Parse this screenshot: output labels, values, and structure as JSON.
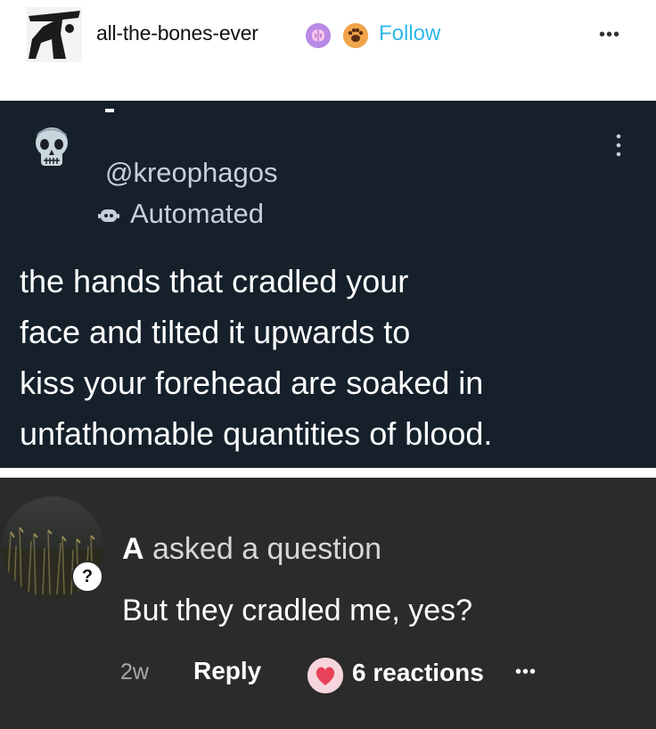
{
  "header": {
    "username": "all-the-bones-ever",
    "follow_label": "Follow",
    "more_label": "•••",
    "icons": [
      "avatar",
      "brain-badge-icon",
      "paw-badge-icon",
      "more-icon"
    ]
  },
  "tweet": {
    "handle": "@kreophagos",
    "automated_label": "Automated",
    "lines": [
      "the hands that cradled your",
      "face and tilted it upwards to",
      "kiss your forehead are soaked in",
      "unfathomable quantities of blood."
    ],
    "colors": {
      "background": "#15202b",
      "text": "#ffffff",
      "muted": "#c7cfd8"
    }
  },
  "comment": {
    "asker": "A",
    "asked_suffix": "asked a question",
    "question_badge": "?",
    "text": "But they cradled me, yes?",
    "time": "2w",
    "reply_label": "Reply",
    "reactions_label": "6 reactions",
    "more_label": "•••",
    "colors": {
      "background": "#2b2b2b",
      "accent": "#e8415a"
    }
  },
  "colors": {
    "follow": "#2fb8e8"
  }
}
